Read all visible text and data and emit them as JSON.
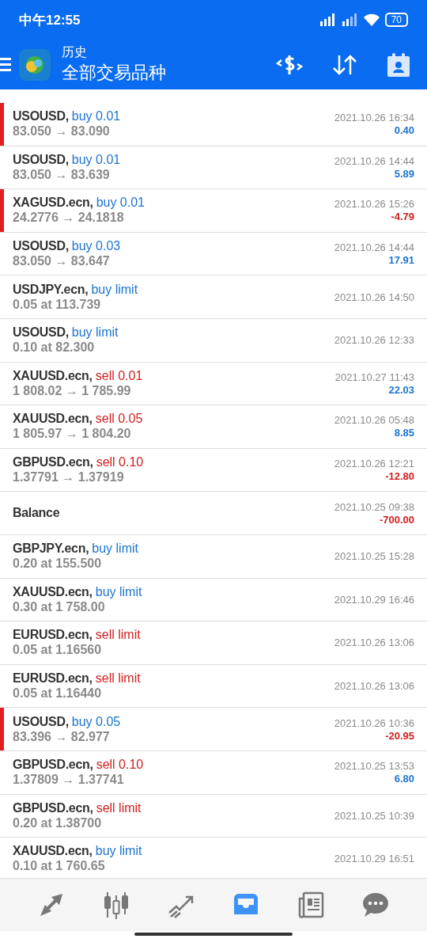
{
  "status_bar": {
    "time": "中午12:55",
    "battery": "70"
  },
  "header": {
    "subtitle": "历史",
    "title": "全部交易品种"
  },
  "orders": [
    {
      "symbol": "USOUSD,",
      "action": "buy 0.01",
      "sell": false,
      "detail": "83.050 → 83.090",
      "date": "2021.10.26 16:34",
      "profit": "0.40",
      "loss": false,
      "marked": true
    },
    {
      "symbol": "USOUSD,",
      "action": "buy 0.01",
      "sell": false,
      "detail": "83.050 → 83.639",
      "date": "2021.10.26 14:44",
      "profit": "5.89",
      "loss": false,
      "marked": false
    },
    {
      "symbol": "XAGUSD.ecn,",
      "action": "buy 0.01",
      "sell": false,
      "detail": "24.2776 → 24.1818",
      "date": "2021.10.26 15:26",
      "profit": "-4.79",
      "loss": true,
      "marked": true
    },
    {
      "symbol": "USOUSD,",
      "action": "buy 0.03",
      "sell": false,
      "detail": "83.050 → 83.647",
      "date": "2021.10.26 14:44",
      "profit": "17.91",
      "loss": false,
      "marked": false
    },
    {
      "symbol": "USDJPY.ecn,",
      "action": "buy limit",
      "sell": false,
      "detail": "0.05 at 113.739",
      "date": "2021.10.26 14:50",
      "marked": false
    },
    {
      "symbol": "USOUSD,",
      "action": "buy limit",
      "sell": false,
      "detail": "0.10 at 82.300",
      "date": "2021.10.26 12:33",
      "marked": false
    },
    {
      "symbol": "XAUUSD.ecn,",
      "action": "sell 0.01",
      "sell": true,
      "detail": "1 808.02 → 1 785.99",
      "date": "2021.10.27 11:43",
      "profit": "22.03",
      "loss": false,
      "marked": false
    },
    {
      "symbol": "XAUUSD.ecn,",
      "action": "sell 0.05",
      "sell": true,
      "detail": "1 805.97 → 1 804.20",
      "date": "2021.10.26 05:48",
      "profit": "8.85",
      "loss": false,
      "marked": false
    },
    {
      "symbol": "GBPUSD.ecn,",
      "action": "sell 0.10",
      "sell": true,
      "detail": "1.37791 → 1.37919",
      "date": "2021.10.26 12:21",
      "profit": "-12.80",
      "loss": true,
      "marked": false
    },
    {
      "symbol": "Balance",
      "date": "2021.10.25 09:38",
      "profit": "-700.00",
      "loss": true,
      "marked": false
    },
    {
      "symbol": "GBPJPY.ecn,",
      "action": "buy limit",
      "sell": false,
      "detail": "0.20 at 155.500",
      "date": "2021.10.25 15:28",
      "marked": false
    },
    {
      "symbol": "XAUUSD.ecn,",
      "action": "buy limit",
      "sell": false,
      "detail": "0.30 at 1 758.00",
      "date": "2021.10.29 16:46",
      "marked": false
    },
    {
      "symbol": "EURUSD.ecn,",
      "action": "sell limit",
      "sell": true,
      "detail": "0.05 at 1.16560",
      "date": "2021.10.26 13:06",
      "marked": false
    },
    {
      "symbol": "EURUSD.ecn,",
      "action": "sell limit",
      "sell": true,
      "detail": "0.05 at 1.16440",
      "date": "2021.10.26 13:06",
      "marked": false
    },
    {
      "symbol": "USOUSD,",
      "action": "buy 0.05",
      "sell": false,
      "detail": "83.396 → 82.977",
      "date": "2021.10.26 10:36",
      "profit": "-20.95",
      "loss": true,
      "marked": true
    },
    {
      "symbol": "GBPUSD.ecn,",
      "action": "sell 0.10",
      "sell": true,
      "detail": "1.37809 → 1.37741",
      "date": "2021.10.25 13:53",
      "profit": "6.80",
      "loss": false,
      "marked": false
    },
    {
      "symbol": "GBPUSD.ecn,",
      "action": "sell limit",
      "sell": true,
      "detail": "0.20 at 1.38700",
      "date": "2021.10.25 10:39",
      "marked": false
    },
    {
      "symbol": "XAUUSD.ecn,",
      "action": "buy limit",
      "sell": false,
      "detail": "0.10 at 1 760.65",
      "date": "2021.10.29 16:51",
      "marked": false
    }
  ],
  "nav": [
    {
      "kind": "trade",
      "selected": false
    },
    {
      "kind": "chart",
      "selected": false
    },
    {
      "kind": "trend",
      "selected": false
    },
    {
      "kind": "history",
      "selected": true
    },
    {
      "kind": "news",
      "selected": false
    },
    {
      "kind": "chat",
      "selected": false
    }
  ]
}
